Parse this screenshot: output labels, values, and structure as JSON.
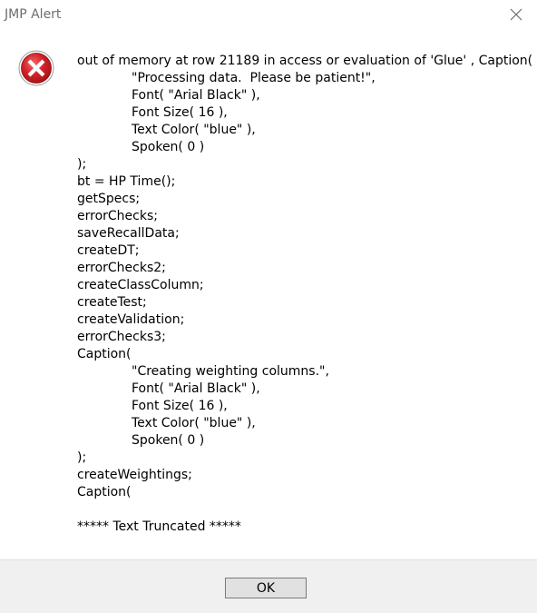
{
  "window": {
    "title": "JMP Alert",
    "close_icon": "close-icon"
  },
  "icon": {
    "name": "error-icon",
    "color": "#c8171e"
  },
  "message": {
    "lines": [
      {
        "text": "out of memory at row 21189 in access or evaluation of 'Glue' , Caption(",
        "indent": false
      },
      {
        "text": "\"Processing data.  Please be patient!\",",
        "indent": true
      },
      {
        "text": "Font( \"Arial Black\" ),",
        "indent": true
      },
      {
        "text": "Font Size( 16 ),",
        "indent": true
      },
      {
        "text": "Text Color( \"blue\" ),",
        "indent": true
      },
      {
        "text": "Spoken( 0 )",
        "indent": true
      },
      {
        "text": ");",
        "indent": false
      },
      {
        "text": "bt = HP Time();",
        "indent": false
      },
      {
        "text": "getSpecs;",
        "indent": false
      },
      {
        "text": "errorChecks;",
        "indent": false
      },
      {
        "text": "saveRecallData;",
        "indent": false
      },
      {
        "text": "createDT;",
        "indent": false
      },
      {
        "text": "errorChecks2;",
        "indent": false
      },
      {
        "text": "createClassColumn;",
        "indent": false
      },
      {
        "text": "createTest;",
        "indent": false
      },
      {
        "text": "createValidation;",
        "indent": false
      },
      {
        "text": "errorChecks3;",
        "indent": false
      },
      {
        "text": "Caption(",
        "indent": false
      },
      {
        "text": "\"Creating weighting columns.\",",
        "indent": true
      },
      {
        "text": "Font( \"Arial Black\" ),",
        "indent": true
      },
      {
        "text": "Font Size( 16 ),",
        "indent": true
      },
      {
        "text": "Text Color( \"blue\" ),",
        "indent": true
      },
      {
        "text": "Spoken( 0 )",
        "indent": true
      },
      {
        "text": ");",
        "indent": false
      },
      {
        "text": "createWeightings;",
        "indent": false
      },
      {
        "text": "Caption(",
        "indent": false
      },
      {
        "text": "",
        "indent": false
      },
      {
        "text": "***** Text Truncated *****",
        "indent": false
      }
    ]
  },
  "footer": {
    "ok_label": "OK"
  }
}
